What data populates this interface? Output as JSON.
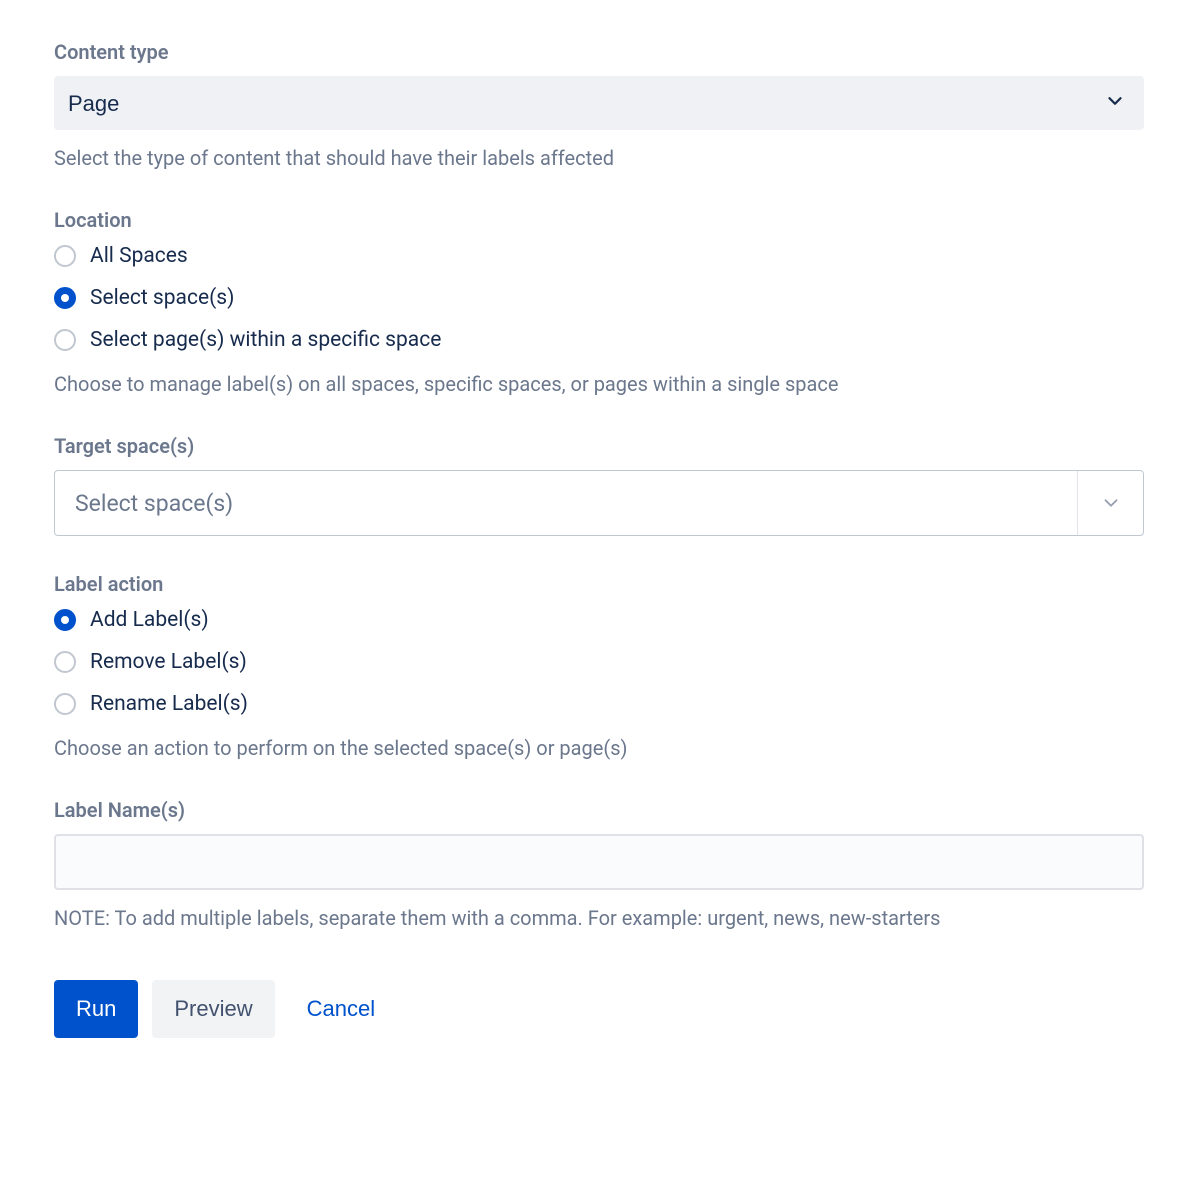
{
  "content_type": {
    "label": "Content type",
    "value": "Page",
    "help": "Select the type of content that should have their labels affected"
  },
  "location": {
    "label": "Location",
    "options": {
      "all": "All Spaces",
      "select_spaces": "Select space(s)",
      "select_pages": "Select page(s) within a specific space"
    },
    "help": "Choose to manage label(s) on all spaces, specific spaces, or pages within a single space"
  },
  "target_spaces": {
    "label": "Target space(s)",
    "placeholder": "Select space(s)"
  },
  "label_action": {
    "label": "Label action",
    "options": {
      "add": "Add Label(s)",
      "remove": "Remove Label(s)",
      "rename": "Rename Label(s)"
    },
    "help": "Choose an action to perform on the selected space(s) or page(s)"
  },
  "label_names": {
    "label": "Label Name(s)",
    "value": "",
    "help": "NOTE: To add multiple labels, separate them with a comma. For example: urgent, news, new-starters"
  },
  "actions": {
    "run": "Run",
    "preview": "Preview",
    "cancel": "Cancel"
  }
}
